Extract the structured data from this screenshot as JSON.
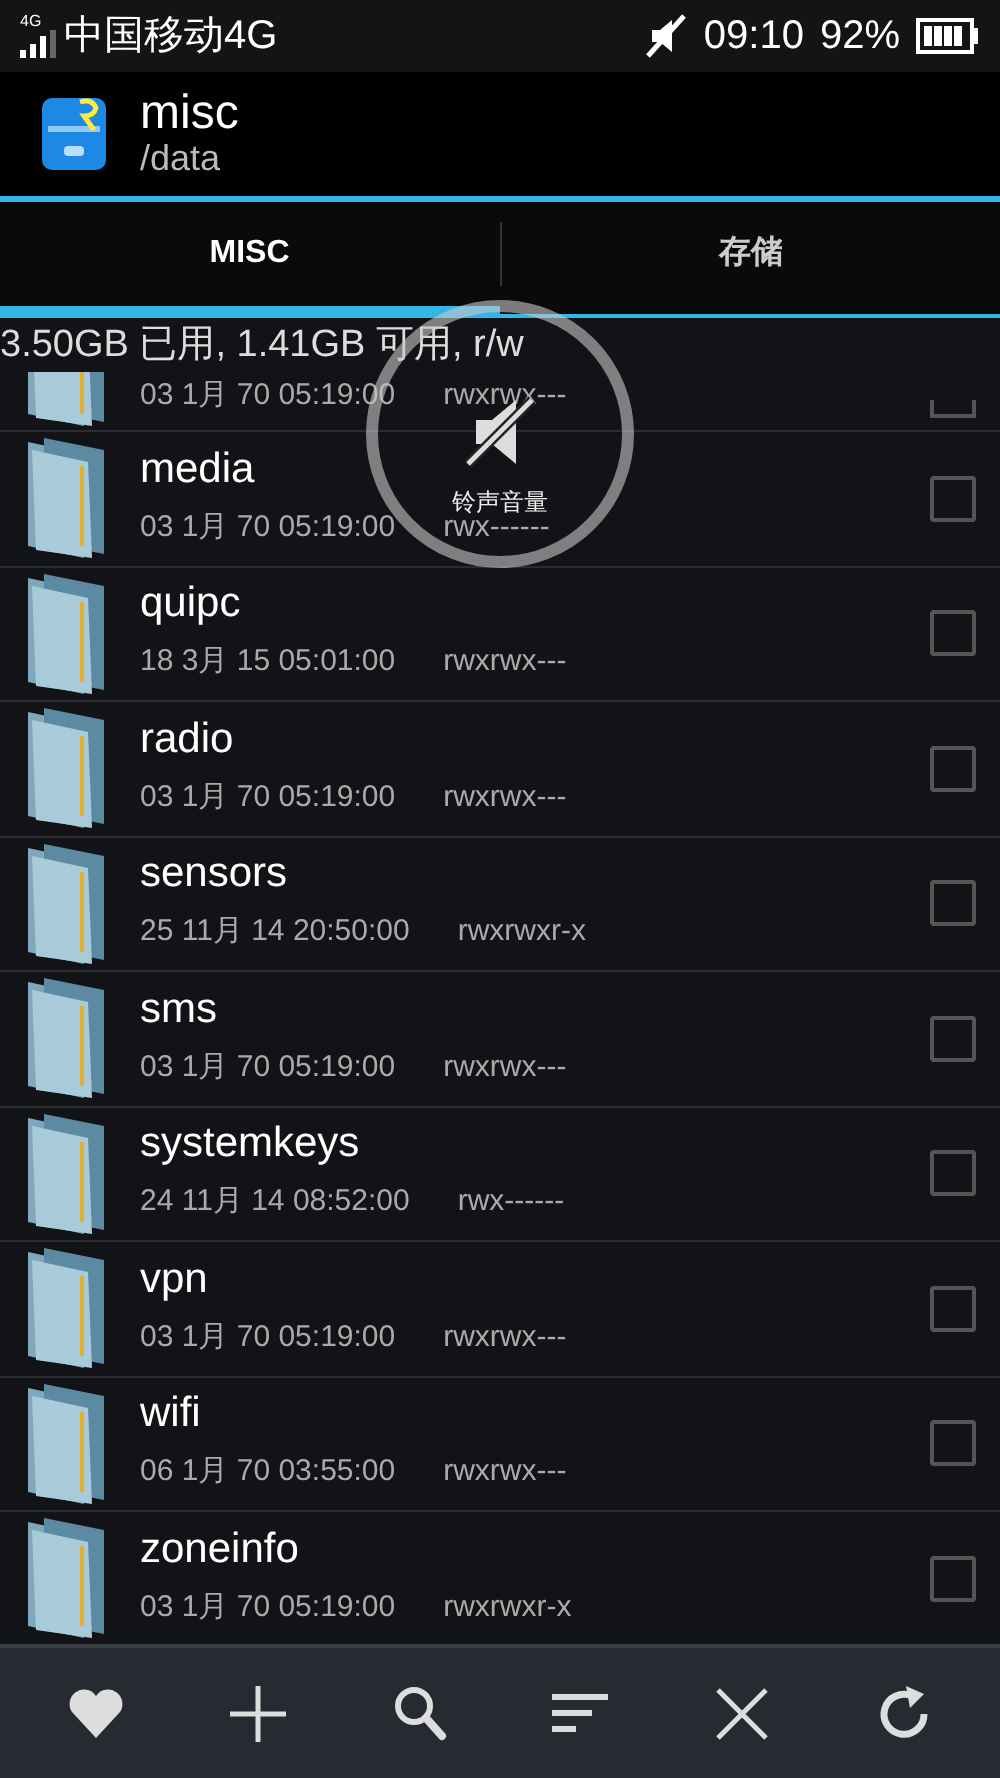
{
  "status_bar": {
    "network_badge": "4G",
    "carrier": "中国移动4G",
    "time": "09:10",
    "battery": "92%"
  },
  "action_bar": {
    "title": "misc",
    "subtitle": "/data"
  },
  "tabs": [
    {
      "label": "MISC",
      "selected": true
    },
    {
      "label": "存储",
      "selected": false
    }
  ],
  "storage_info": "3.50GB 已用, 1.41GB 可用, r/w",
  "files": [
    {
      "date": "03 1月 70 05:19:00",
      "permissions": "rwxrwx---",
      "checked": false
    },
    {
      "name": "media",
      "date": "03 1月 70 05:19:00",
      "permissions": "rwx------",
      "checked": false
    },
    {
      "name": "quipc",
      "date": "18 3月 15 05:01:00",
      "permissions": "rwxrwx---",
      "checked": false
    },
    {
      "name": "radio",
      "date": "03 1月 70 05:19:00",
      "permissions": "rwxrwx---",
      "checked": false
    },
    {
      "name": "sensors",
      "date": "25 11月 14 20:50:00",
      "permissions": "rwxrwxr-x",
      "checked": false
    },
    {
      "name": "sms",
      "date": "03 1月 70 05:19:00",
      "permissions": "rwxrwx---",
      "checked": false
    },
    {
      "name": "systemkeys",
      "date": "24 11月 14 08:52:00",
      "permissions": "rwx------",
      "checked": false
    },
    {
      "name": "vpn",
      "date": "03 1月 70 05:19:00",
      "permissions": "rwxrwx---",
      "checked": false
    },
    {
      "name": "wifi",
      "date": "06 1月 70 03:55:00",
      "permissions": "rwxrwx---",
      "checked": false
    },
    {
      "name": "zoneinfo",
      "date": "03 1月 70 05:19:00",
      "permissions": "rwxrwxr-x",
      "checked": false
    }
  ],
  "volume_toast": {
    "label": "铃声音量"
  },
  "toolbar": [
    {
      "kind": "heart"
    },
    {
      "kind": "plus"
    },
    {
      "kind": "search"
    },
    {
      "kind": "sort"
    },
    {
      "kind": "close"
    },
    {
      "kind": "refresh"
    }
  ]
}
